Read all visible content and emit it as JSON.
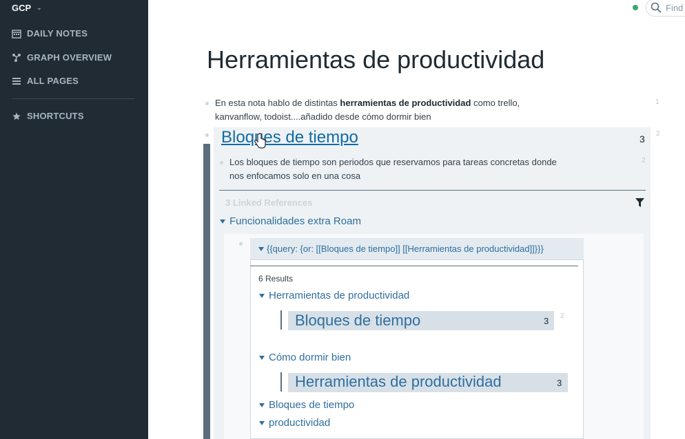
{
  "sidebar": {
    "graph_name": "GCP",
    "items": [
      {
        "label": "DAILY NOTES",
        "icon": "calendar-icon"
      },
      {
        "label": "GRAPH OVERVIEW",
        "icon": "graph-icon"
      },
      {
        "label": "ALL PAGES",
        "icon": "list-icon"
      },
      {
        "label": "SHORTCUTS",
        "icon": "star-icon"
      }
    ]
  },
  "topbar": {
    "search_placeholder": "Find"
  },
  "page": {
    "title": "Herramientas de productividad",
    "block1": {
      "text_pre": "En esta nota hablo de distintas ",
      "text_bold": "herramientas de productividad",
      "text_post": " como trello, kanvanflow, todoist....añadido desde cómo dormir bien",
      "line_number": "1"
    },
    "block2": {
      "line_number": "2"
    },
    "embed": {
      "title": "Bloques de tiempo",
      "count": "3",
      "child_text": "Los bloques de tiempo son periodos que reservamos para tareas concretas donde nos enfocamos solo en una cosa",
      "child_line_number": "2",
      "linked_refs_label": "3 Linked References",
      "ref_group": "Funcionalidades extra Roam",
      "query": {
        "text": "{{query:  {or: [[Bloques de tiempo]] [[Herramientas de productividad]]}}}",
        "results_label": "6 Results",
        "groups": [
          {
            "title": "Herramientas de productividad",
            "link": "Bloques de tiempo",
            "count": "3",
            "line_number": "2"
          },
          {
            "title": "Cómo dormir bien",
            "link": "Herramientas de productividad",
            "count": "3"
          },
          {
            "title": "Bloques de tiempo"
          },
          {
            "title": "productividad"
          }
        ]
      }
    }
  },
  "colors": {
    "sidebar_bg": "#202b33",
    "link": "#2f6e9e",
    "status": "#3da66b"
  }
}
